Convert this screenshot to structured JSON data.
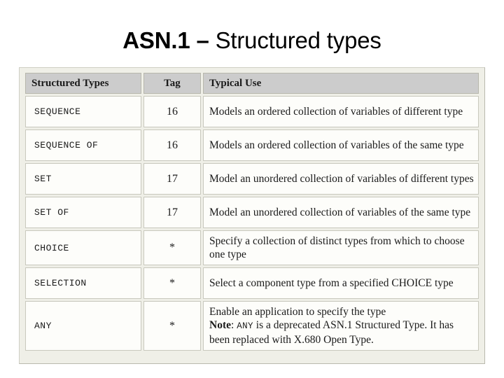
{
  "slide": {
    "title_strong": "ASN.1 – ",
    "title_rest": "Structured types"
  },
  "table": {
    "headers": {
      "type": "Structured Types",
      "tag": "Tag",
      "use": "Typical Use"
    },
    "rows": [
      {
        "type": "SEQUENCE",
        "tag": "16",
        "use": "Models an ordered collection of variables of different type"
      },
      {
        "type": "SEQUENCE OF",
        "tag": "16",
        "use": "Models an ordered collection of variables of the same type"
      },
      {
        "type": "SET",
        "tag": "17",
        "use": "Model an unordered collection of variables of different types"
      },
      {
        "type": "SET OF",
        "tag": "17",
        "use": "Model an unordered collection of variables of the same type"
      },
      {
        "type": "CHOICE",
        "tag": "*",
        "use": "Specify a collection of distinct types from which to choose one type"
      },
      {
        "type": "SELECTION",
        "tag": "*",
        "use": "Select a component type from a specified CHOICE type"
      },
      {
        "type": "ANY",
        "tag": "*",
        "use_line1": "Enable an application to specify the type",
        "use_note_label": "Note",
        "use_note_sep": ": ",
        "use_note_mono": "ANY",
        "use_note_rest": " is a deprecated ASN.1 Structured Type. It has been replaced with X.680 Open Type."
      }
    ]
  },
  "colors": {
    "page_background": "#ffffff",
    "frame_background": "#efefe7",
    "header_background": "#cccccc",
    "cell_background": "#fdfdfa",
    "text": "#1a1a1a",
    "border": "#c8c8bd"
  }
}
